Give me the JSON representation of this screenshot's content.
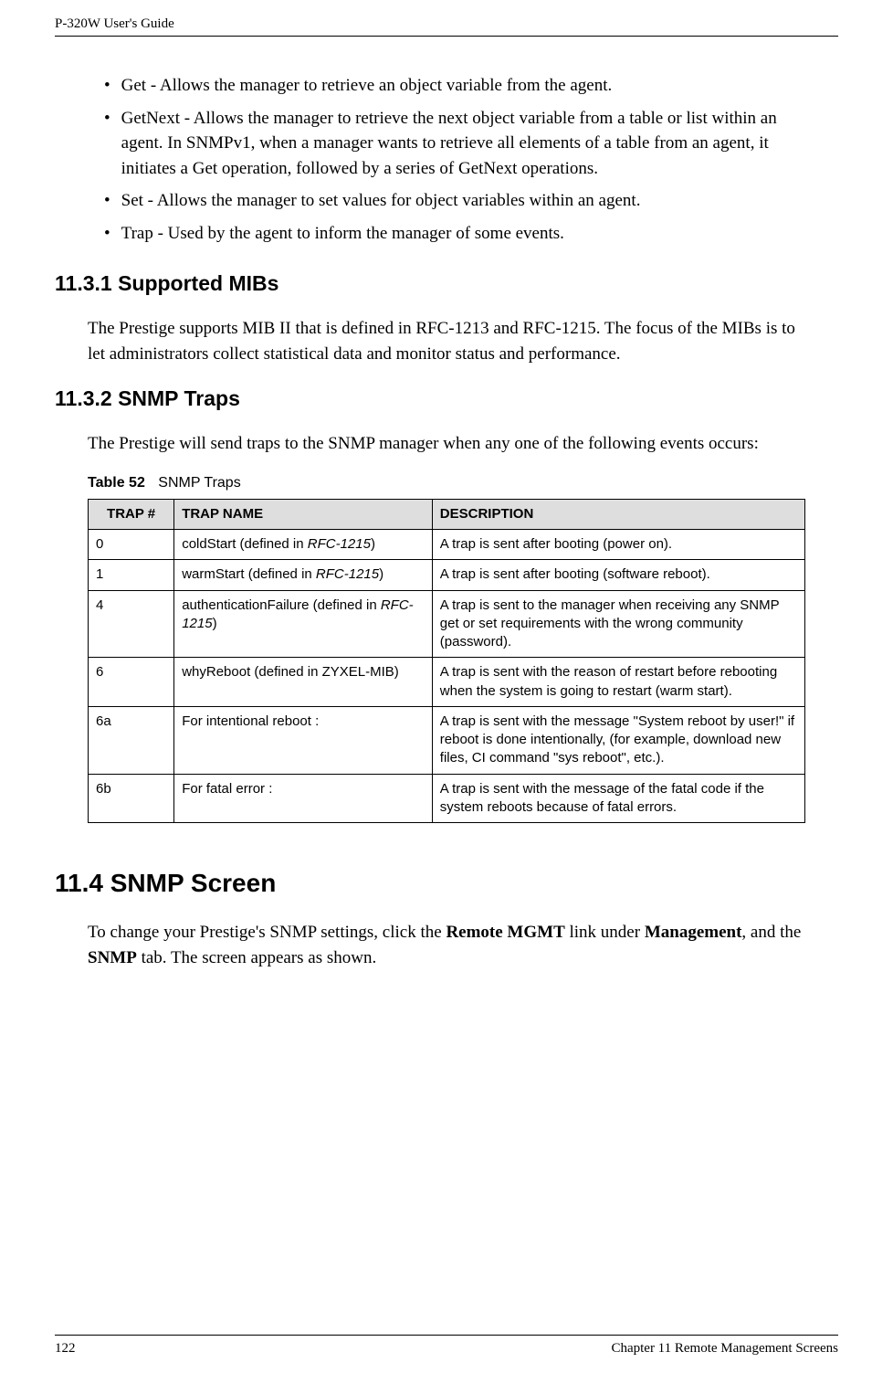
{
  "header": {
    "left": "P-320W User's Guide"
  },
  "footer": {
    "left": "122",
    "right": "Chapter 11 Remote Management Screens"
  },
  "bullets": [
    "Get - Allows the manager to retrieve an object variable from the agent.",
    "GetNext - Allows the manager to retrieve the next object variable from a table or list within an agent. In SNMPv1, when a manager wants to retrieve all elements of a table from an agent, it initiates a Get operation, followed by a series of GetNext operations.",
    "Set - Allows the manager to set values for object variables within an agent.",
    "Trap - Used by the agent to inform the manager of some events."
  ],
  "sections": {
    "s1131": {
      "heading": "11.3.1  Supported MIBs",
      "para": "The Prestige supports MIB II that is defined in RFC-1213 and RFC-1215. The focus of the MIBs is to let administrators collect statistical data and monitor status and performance."
    },
    "s1132": {
      "heading": "11.3.2  SNMP Traps",
      "para": "The Prestige will send traps to the SNMP manager when any one of the following events occurs:"
    },
    "s114": {
      "heading": "11.4  SNMP Screen",
      "para_pre": "To change your Prestige's SNMP settings, click the ",
      "bold1": "Remote MGMT",
      "mid1": " link under ",
      "bold2": "Management",
      "mid2": ", and the ",
      "bold3": "SNMP",
      "post": " tab. The screen appears as shown."
    }
  },
  "table": {
    "caption_num": "Table 52",
    "caption_text": "SNMP Traps",
    "headers": {
      "c1": "TRAP #",
      "c2": "TRAP NAME",
      "c3": "DESCRIPTION"
    },
    "rows": [
      {
        "num": "0",
        "name_pre": "coldStart (defined in ",
        "name_it": "RFC-1215",
        "name_post": ")",
        "desc": "A trap is sent after booting (power on)."
      },
      {
        "num": "1",
        "name_pre": "warmStart (defined in ",
        "name_it": "RFC-1215",
        "name_post": ")",
        "desc": "A trap is sent after booting (software reboot)."
      },
      {
        "num": "4",
        "name_pre": "authenticationFailure (defined in ",
        "name_it": "RFC-1215",
        "name_post": ")",
        "desc": "A trap is sent to the manager when receiving any SNMP get or set requirements with the wrong community (password)."
      },
      {
        "num": "6",
        "name_pre": "whyReboot (defined in ZYXEL-MIB)",
        "name_it": "",
        "name_post": "",
        "desc": "A trap is sent with the reason of restart before rebooting when the system is going to restart (warm start)."
      },
      {
        "num": "6a",
        "name_pre": "For intentional reboot :",
        "name_it": "",
        "name_post": "",
        "desc": "A trap is sent with the message \"System reboot by user!\" if reboot is done intentionally, (for example, download new files, CI command \"sys reboot\", etc.)."
      },
      {
        "num": "6b",
        "name_pre": "For fatal error :",
        "name_it": "",
        "name_post": "",
        "desc": "A trap is sent with the message of the fatal code if the system reboots because of fatal errors."
      }
    ]
  }
}
